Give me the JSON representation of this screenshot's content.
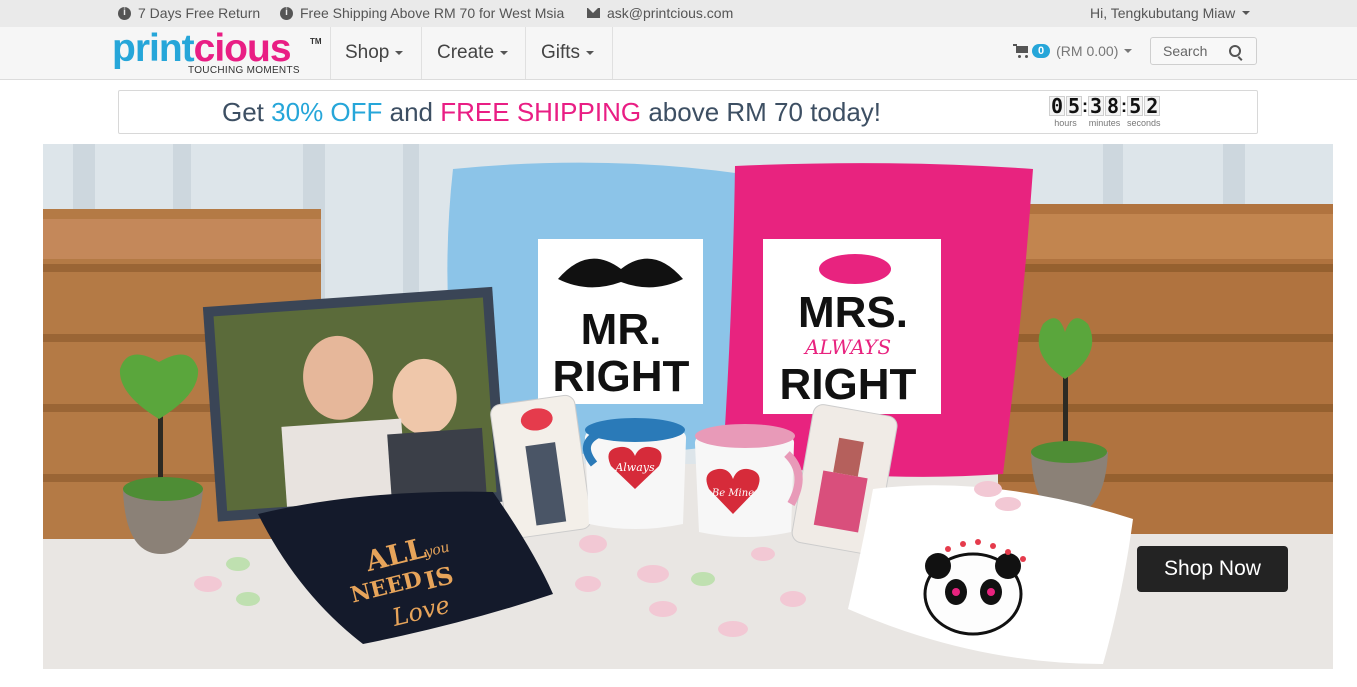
{
  "topbar": {
    "return_text": "7 Days Free Return",
    "shipping_text": "Free Shipping Above RM 70 for West Msia",
    "email_text": "ask@printcious.com",
    "greeting": "Hi, Tengkubutang Miaw"
  },
  "logo": {
    "part1": "print",
    "part2": "cious",
    "tm": "TM",
    "tagline": "TOUCHING MOMENTS"
  },
  "nav": {
    "shop": "Shop",
    "create": "Create",
    "gifts": "Gifts"
  },
  "cart": {
    "count": "0",
    "total": "(RM 0.00)"
  },
  "search": {
    "placeholder": "Search"
  },
  "promo": {
    "get": "Get",
    "discount": "30% OFF",
    "and": "and",
    "free_shipping": "FREE SHIPPING",
    "rest": "above RM 70 today!",
    "countdown": {
      "hours": [
        "0",
        "5"
      ],
      "minutes": [
        "3",
        "8"
      ],
      "seconds": [
        "5",
        "2"
      ],
      "hours_label": "hours",
      "minutes_label": "minutes",
      "seconds_label": "seconds"
    }
  },
  "hero": {
    "pillow_left_line1": "MR.",
    "pillow_left_line2": "RIGHT",
    "pillow_right_line1": "MRS.",
    "pillow_right_script": "ALWAYS",
    "pillow_right_line2": "RIGHT",
    "mug_left_text": "Always",
    "mug_right_text": "Be Mine",
    "tshirt_line1": "ALL",
    "tshirt_line2": "you",
    "tshirt_line3": "NEED",
    "tshirt_line4": "IS",
    "tshirt_line5": "Love",
    "shop_now": "Shop Now"
  },
  "colors": {
    "brand_blue": "#26a6d9",
    "brand_pink": "#e91e84"
  }
}
